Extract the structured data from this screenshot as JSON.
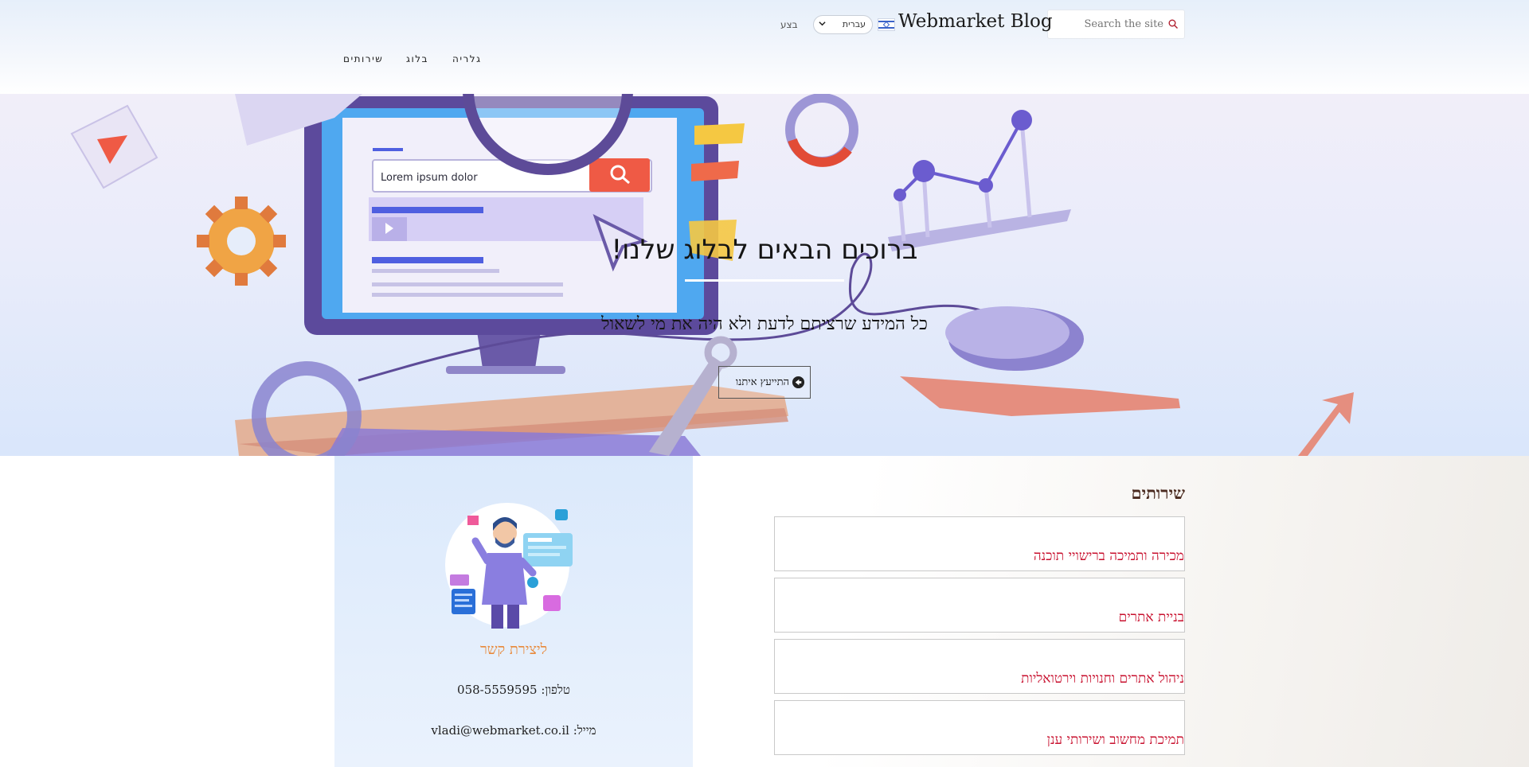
{
  "header": {
    "search_placeholder": "Search the site",
    "brand_title": "Webmarket Blog",
    "language": "עברית",
    "mini_label": "בצע",
    "nav": [
      "גלריה",
      "בלוג",
      "שירותים"
    ]
  },
  "hero": {
    "title": "ברוכים הבאים לבלוג שלנו!",
    "subtitle": "כל המידע שרציתם לדעת ולא היה את מי לשאול",
    "cta": "התייעץ איתנו",
    "screen_search_text": "Lorem ipsum dolor"
  },
  "services": {
    "title": "שירותים",
    "items": [
      "מכירה ותמיכה ברישויי תוכנה",
      "בניית אתרים",
      "ניהול אתרים וחנויות וירטואליות",
      "תמיכת מחשוב ושירותי ענן"
    ]
  },
  "contact": {
    "title": "ליצירת קשר",
    "phone": "טלפון: 058-5559595",
    "email": "מייל: vladi@webmarket.co.il"
  },
  "colors": {
    "accent_orange": "#e8893a",
    "service_red": "#c8102e",
    "hero_bg": "#e3e9fa"
  }
}
